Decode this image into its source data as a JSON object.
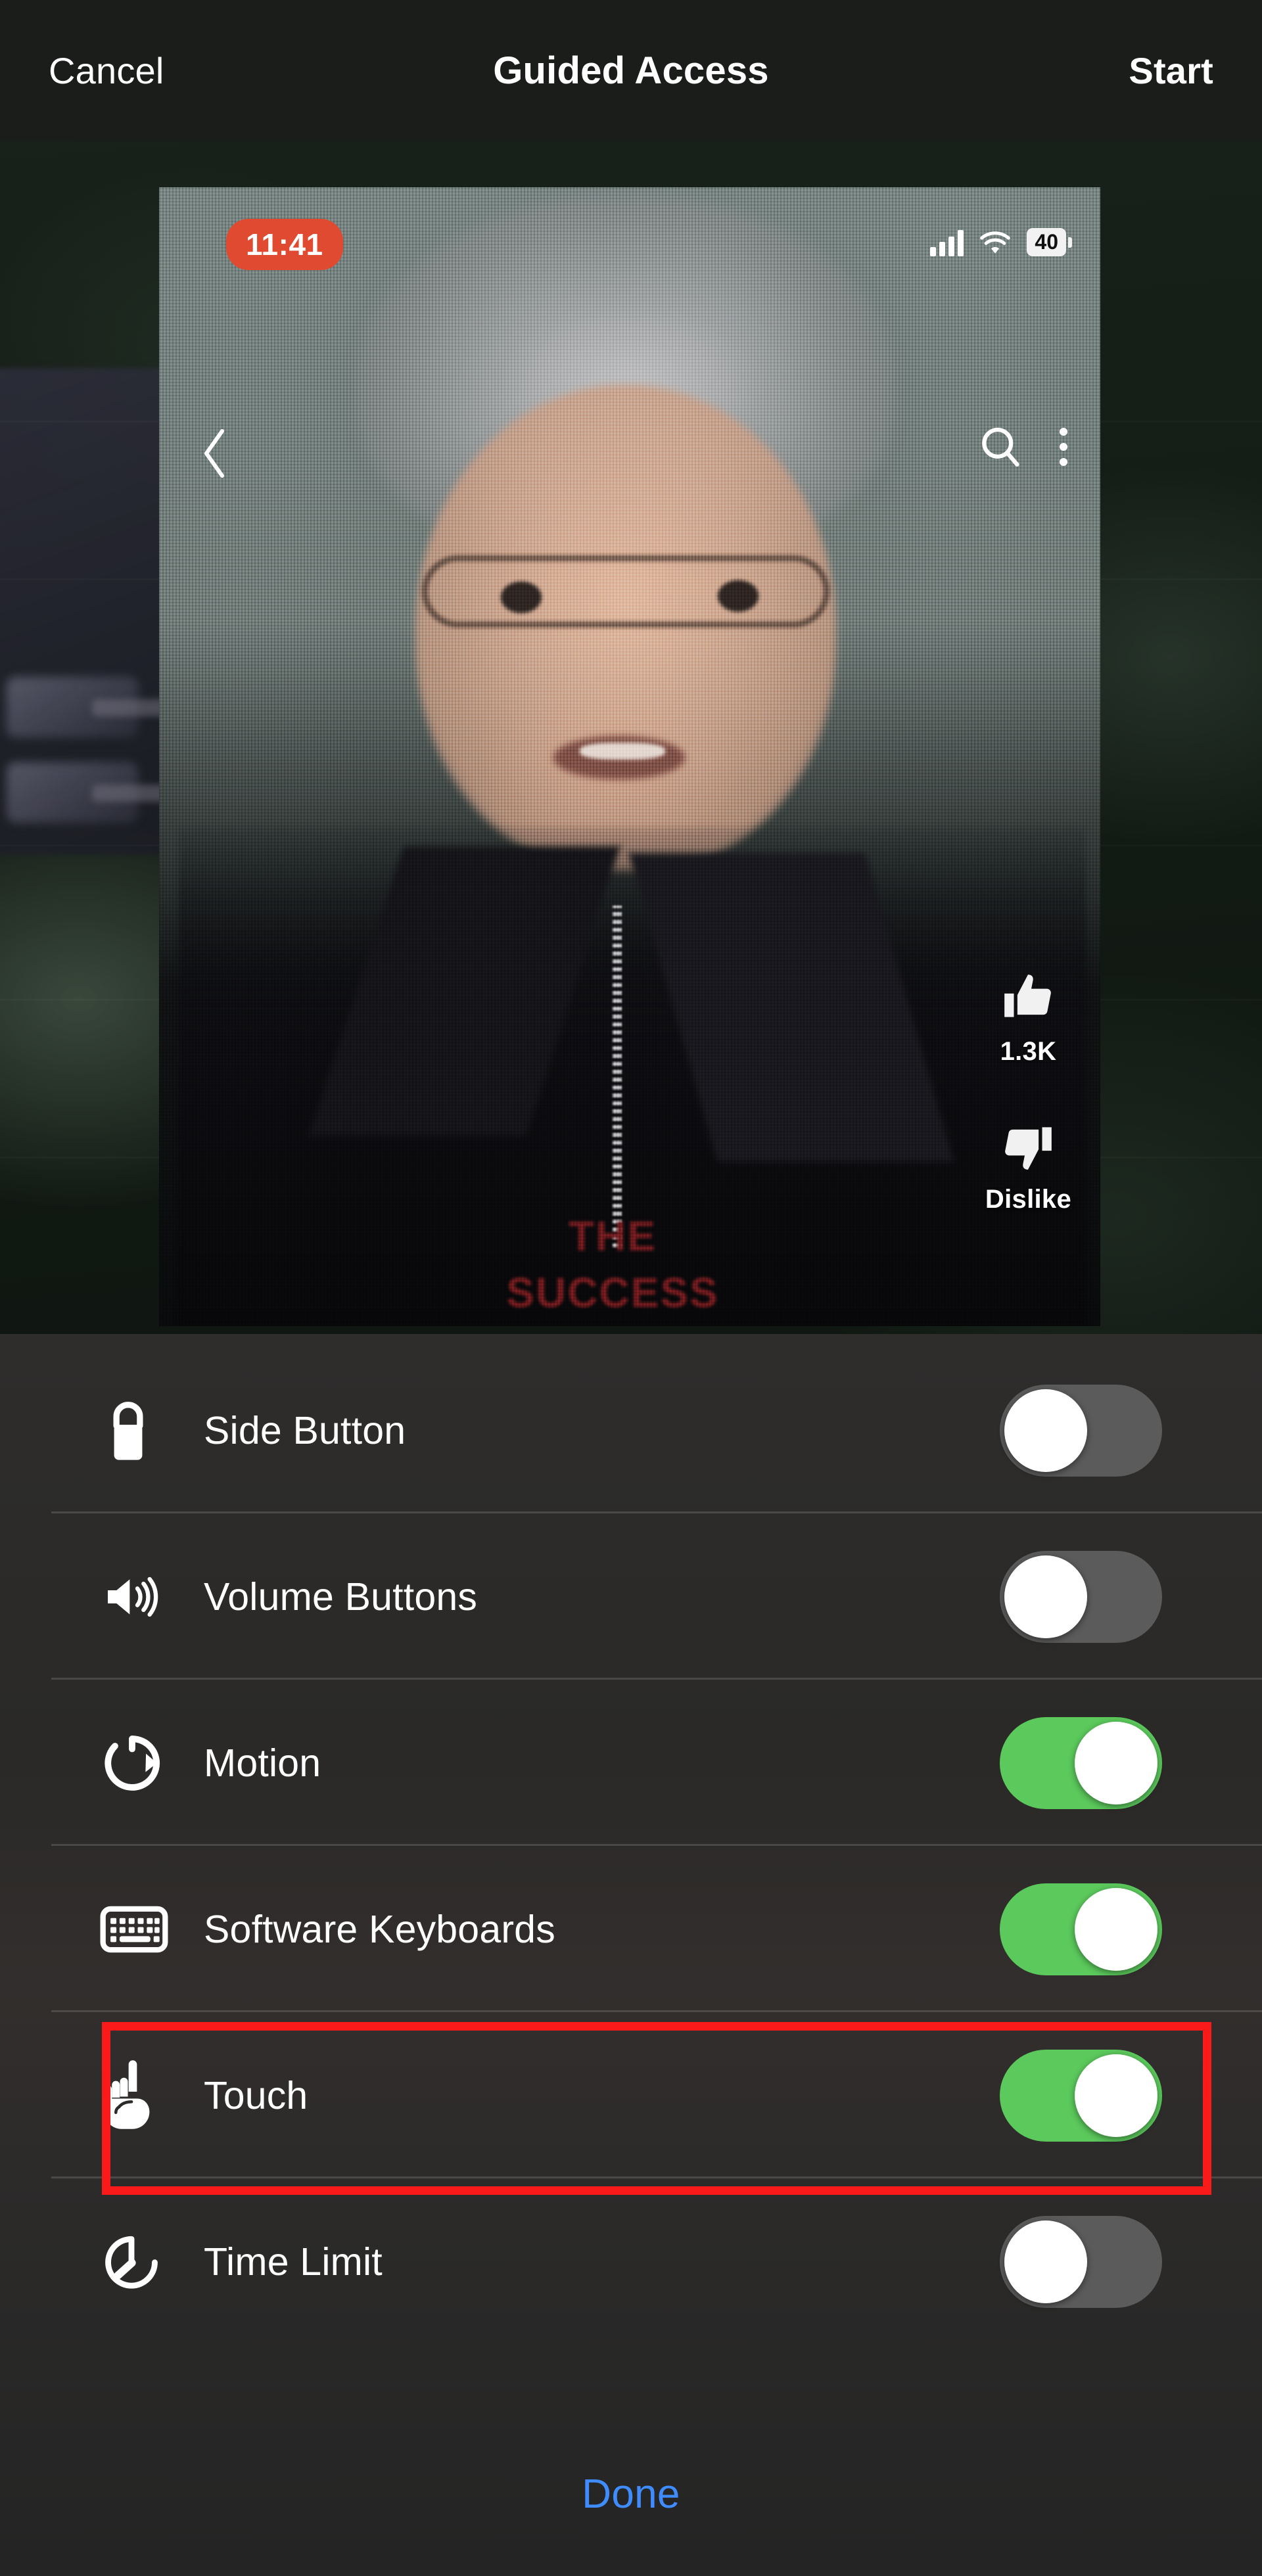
{
  "topbar": {
    "cancel_label": "Cancel",
    "title": "Guided Access",
    "start_label": "Start"
  },
  "preview": {
    "status": {
      "time": "11:41",
      "battery": "40",
      "signal_icon": "cellular-signal-icon",
      "wifi_icon": "wifi-icon"
    },
    "nav": {
      "back_icon": "back-chevron-icon",
      "search_icon": "search-icon",
      "menu_icon": "kebab-menu-icon"
    },
    "rail": {
      "like_icon": "thumbs-up-icon",
      "like_count": "1.3K",
      "dislike_icon": "thumbs-down-icon",
      "dislike_label": "Dislike"
    },
    "shirt_text_line1": "THE",
    "shirt_text_line2": "SUCCESS"
  },
  "settings": {
    "rows": [
      {
        "icon": "lock-icon",
        "label": "Side Button",
        "enabled": false
      },
      {
        "icon": "speaker-icon",
        "label": "Volume Buttons",
        "enabled": false
      },
      {
        "icon": "rotate-icon",
        "label": "Motion",
        "enabled": true
      },
      {
        "icon": "keyboard-icon",
        "label": "Software Keyboards",
        "enabled": true
      },
      {
        "icon": "touch-hand-icon",
        "label": "Touch",
        "enabled": true,
        "highlighted": true
      },
      {
        "icon": "timer-icon",
        "label": "Time Limit",
        "enabled": false
      }
    ],
    "done_label": "Done"
  },
  "colors": {
    "toggle_on": "#5bc95c",
    "toggle_off": "#5b5b5b",
    "highlight": "#fb1a1a",
    "done_blue": "#3f8cff",
    "time_pill": "#e04a31"
  }
}
